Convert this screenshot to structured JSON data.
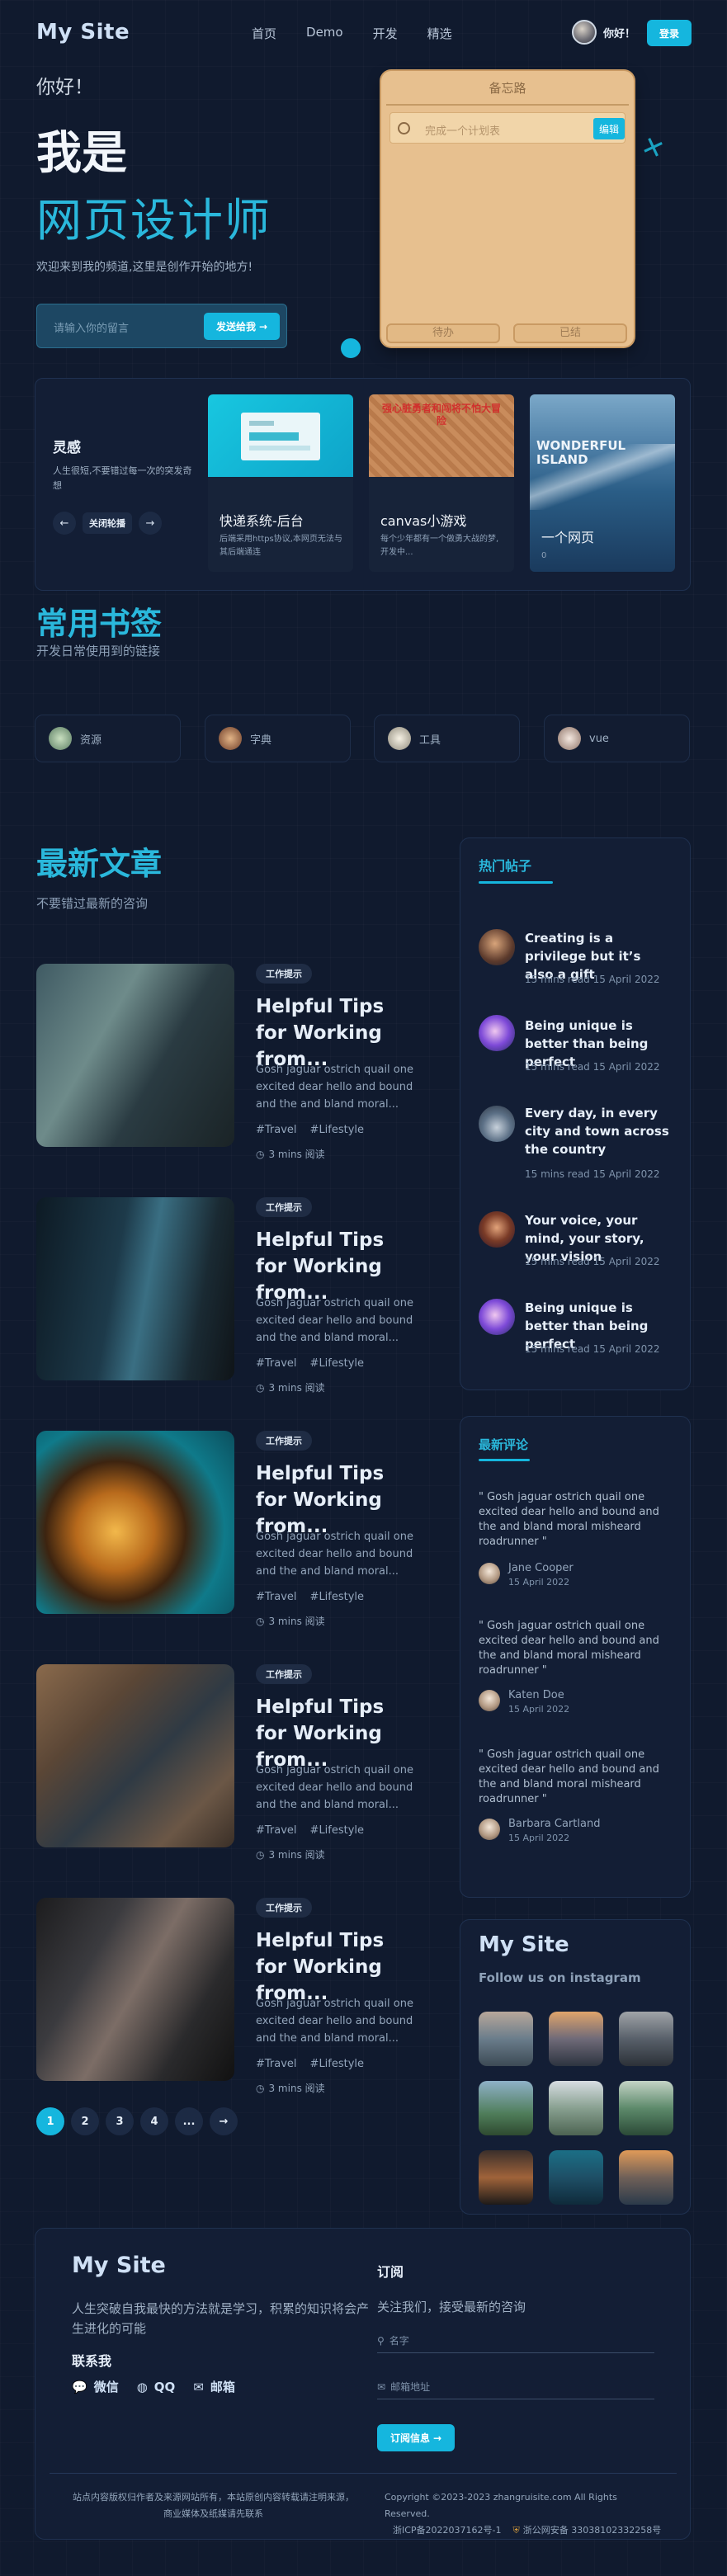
{
  "header": {
    "logo": "My Site",
    "nav": [
      "首页",
      "Demo",
      "开发",
      "精选"
    ],
    "user_name": "你好！",
    "login_label": "登录"
  },
  "hero": {
    "greeting": "你好！",
    "iam": "我是",
    "role": "网页设计师",
    "welcome": "欢迎来到我的频道,这里是创作开始的地方!",
    "search_placeholder": "请输入你的留言",
    "search_button": "发送给我"
  },
  "memo": {
    "title": "备忘路",
    "input_placeholder": "完成一个计划表",
    "edit_label": "编辑",
    "tab_todo": "待办",
    "tab_done": "已结"
  },
  "inspiration": {
    "title": "灵感",
    "desc": "人生很短,不要错过每一次的突发奇想",
    "toggle_label": "关闭轮播",
    "projects": [
      {
        "name": "快递系统-后台",
        "desc": "后端采用https协议,本网页无法与其后端通连",
        "img_text": ""
      },
      {
        "name": "canvas小游戏",
        "desc": "每个少年都有一个做勇大战的梦,开发中...",
        "img_text": "强心脏勇者和闯将不怕大冒险"
      },
      {
        "name": "一个网页",
        "desc": "0",
        "img_text": "WONDERFUL ISLAND"
      }
    ]
  },
  "bookmarks": {
    "title": "常用书签",
    "subtitle": "开发日常使用到的链接",
    "items": [
      "资源",
      "字典",
      "工具",
      "vue"
    ]
  },
  "articles": {
    "title": "最新文章",
    "subtitle": "不要错过最新的咨询",
    "items": [
      {
        "tag": "工作提示",
        "title": "Helpful Tips for Working from...",
        "excerpt": "Gosh jaguar ostrich quail one excited dear hello and bound and the and bland moral...",
        "tags": [
          "#Travel",
          "#Lifestyle"
        ],
        "read": "3 mins 阅读"
      },
      {
        "tag": "工作提示",
        "title": "Helpful Tips for Working from...",
        "excerpt": "Gosh jaguar ostrich quail one excited dear hello and bound and the and bland moral...",
        "tags": [
          "#Travel",
          "#Lifestyle"
        ],
        "read": "3 mins 阅读"
      },
      {
        "tag": "工作提示",
        "title": "Helpful Tips for Working from...",
        "excerpt": "Gosh jaguar ostrich quail one excited dear hello and bound and the and bland moral...",
        "tags": [
          "#Travel",
          "#Lifestyle"
        ],
        "read": "3 mins 阅读"
      },
      {
        "tag": "工作提示",
        "title": "Helpful Tips for Working from...",
        "excerpt": "Gosh jaguar ostrich quail one excited dear hello and bound and the and bland moral...",
        "tags": [
          "#Travel",
          "#Lifestyle"
        ],
        "read": "3 mins 阅读"
      },
      {
        "tag": "工作提示",
        "title": "Helpful Tips for Working from...",
        "excerpt": "Gosh jaguar ostrich quail one excited dear hello and bound and the and bland moral...",
        "tags": [
          "#Travel",
          "#Lifestyle"
        ],
        "read": "3 mins 阅读"
      }
    ],
    "pagination": [
      "1",
      "2",
      "3",
      "4",
      "...",
      "→"
    ]
  },
  "hot_posts": {
    "title": "热门帖子",
    "items": [
      {
        "title": "Creating is a privilege but it’s also a gift",
        "meta": "15 mins read 15 April 2022"
      },
      {
        "title": "Being unique is better than being perfect",
        "meta": "15 mins read 15 April 2022"
      },
      {
        "title": "Every day, in every city and town across the country",
        "meta": "15 mins read 15 April 2022"
      },
      {
        "title": "Your voice, your mind, your story, your vision",
        "meta": "15 mins read 15 April 2022"
      },
      {
        "title": "Being unique is better than being perfect",
        "meta": "15 mins read 15 April 2022"
      }
    ]
  },
  "comments": {
    "title": "最新评论",
    "items": [
      {
        "text": "\" Gosh jaguar ostrich quail one excited dear hello and bound and the and bland moral misheard roadrunner \"",
        "name": "Jane Cooper",
        "date": "15 April 2022"
      },
      {
        "text": "\" Gosh jaguar ostrich quail one excited dear hello and bound and the and bland moral misheard roadrunner \"",
        "name": "Katen Doe",
        "date": "15 April 2022"
      },
      {
        "text": "\" Gosh jaguar ostrich quail one excited dear hello and bound and the and bland moral misheard roadrunner \"",
        "name": "Barbara Cartland",
        "date": "15 April 2022"
      }
    ]
  },
  "instagram": {
    "title": "My Site",
    "subtitle": "Follow us on instagram"
  },
  "footer": {
    "logo": "My Site",
    "desc": "人生突破自我最快的方法就是学习，积累的知识将会产生进化的可能",
    "contact_title": "联系我",
    "contacts": [
      "微信",
      "QQ",
      "邮箱"
    ],
    "subscribe_title": "订阅",
    "subscribe_desc": "关注我们，接受最新的咨询",
    "name_placeholder": "名字",
    "email_placeholder": "邮箱地址",
    "subscribe_button": "订阅信息",
    "left_text": "站点内容版权归作者及来源网站所有，本站原创内容转载请注明来源，商业媒体及纸媒请先联系",
    "copyright": "Copyright ©2023-2023 zhangruisite.com All Rights Reserved.",
    "icp": "浙ICP备2022037162号-1",
    "police": "浙公网安备 33038102332258号"
  },
  "colors": {
    "accent": "#15b6de",
    "background": "#101a2e",
    "panel": "#131e35",
    "memo": "#e7c08f"
  }
}
